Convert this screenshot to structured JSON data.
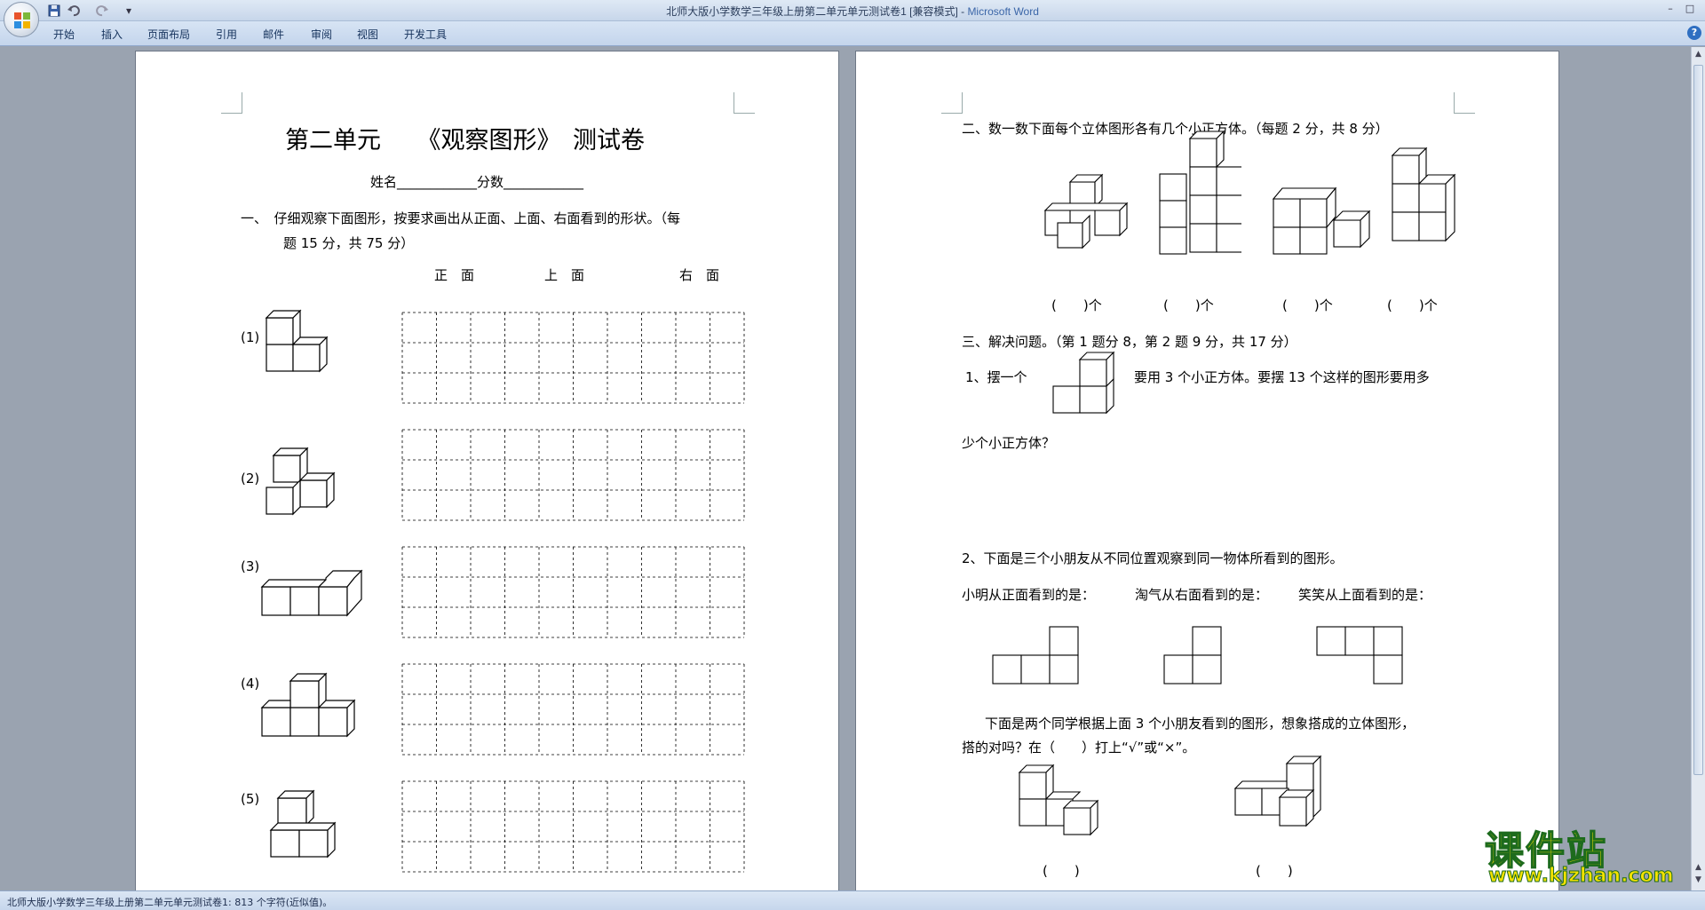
{
  "window": {
    "title_doc": "北师大版小学数学三年级上册第二单元单元测试卷1 [兼容模式] - ",
    "title_app": "Microsoft Word",
    "qat": {
      "save_icon": "save-icon",
      "undo_icon": "undo-icon",
      "redo_icon": "redo-icon",
      "customize_label": "▾"
    },
    "controls": {
      "minimize": "–",
      "restore": "□",
      "close": "✕"
    }
  },
  "ribbon": {
    "tabs": [
      "开始",
      "插入",
      "页面布局",
      "引用",
      "邮件",
      "审阅",
      "视图",
      "开发工具"
    ],
    "help": "?"
  },
  "left_page": {
    "title": "第二单元　　《观察图形》　测试卷",
    "name_line": "姓名____________分数____________",
    "q1_line1": "一、　仔细观察下面图形，按要求画出从正面、上面、右面看到的形状。（每",
    "q1_line2": "题 15 分，共 75 分）",
    "col_front": "正　面",
    "col_top": "上　面",
    "col_right": "右　面",
    "items": [
      "(1)",
      "(2)",
      "(3)",
      "(4)",
      "(5)"
    ]
  },
  "right_page": {
    "q2": "二、数一数下面每个立体图形各有几个小正方体。（每题 2 分，共 8 分）",
    "answer_blanks": [
      "(　　)个",
      "(　　)个",
      "(　　)个",
      "(　　)个"
    ],
    "q3": "三、解决问题。（第 1 题分 8，第 2 题 9 分，共 17 分）",
    "q3_1a": "1、摆一个",
    "q3_1b": "要用 3 个小正方体。要摆 13 个这样的图形要用多",
    "q3_1c": "少个小正方体？",
    "q3_2": "2、下面是三个小朋友从不同位置观察到同一物体所看到的图形。",
    "view_xiaoming": "小明从正面看到的是：",
    "view_taoqi": "淘气从右面看到的是：",
    "view_xiaoxiao": "笑笑从上面看到的是：",
    "q3_2b_line1": "下面是两个同学根据上面 3 个小朋友看到的图形，想象搭成的立体图形，",
    "q3_2b_line2": "搭的对吗？在（　　）打上“√”或“×”。",
    "judge_blanks": [
      "(　　)",
      "(　　)"
    ]
  },
  "status": {
    "text": "北师大版小学数学三年级上册第二单元单元测试卷1: 813 个字符(近似值)。"
  },
  "watermark": {
    "main": "课件站",
    "url": "www.kjzhan.com"
  },
  "colors": {
    "accent": "#3b66a8",
    "page_bg": "#ffffff",
    "workspace": "#9aa3b0",
    "watermark": "#f4e200"
  }
}
